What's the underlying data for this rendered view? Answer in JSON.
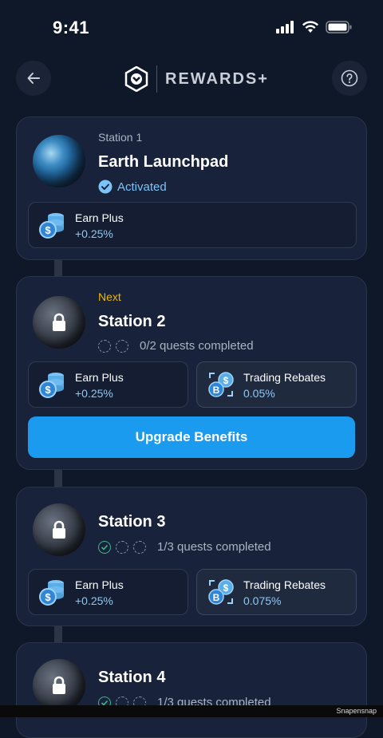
{
  "status": {
    "time": "9:41"
  },
  "header": {
    "brand": "REWARDS+"
  },
  "stations": [
    {
      "label": "Station 1",
      "title": "Earth Launchpad",
      "status": "Activated",
      "benefits": [
        {
          "name": "Earn Plus",
          "value": "+0.25%"
        }
      ]
    },
    {
      "label": "Next",
      "title": "Station 2",
      "quests": "0/2 quests completed",
      "benefits": [
        {
          "name": "Earn Plus",
          "value": "+0.25%"
        },
        {
          "name": "Trading Rebates",
          "value": "0.05%"
        }
      ],
      "button": "Upgrade Benefits"
    },
    {
      "title": "Station 3",
      "quests": "1/3 quests completed",
      "benefits": [
        {
          "name": "Earn Plus",
          "value": "+0.25%"
        },
        {
          "name": "Trading Rebates",
          "value": "0.075%"
        }
      ]
    },
    {
      "title": "Station 4",
      "quests": "1/3 quests completed"
    }
  ],
  "footer": {
    "watermark": "Snapensnap"
  }
}
